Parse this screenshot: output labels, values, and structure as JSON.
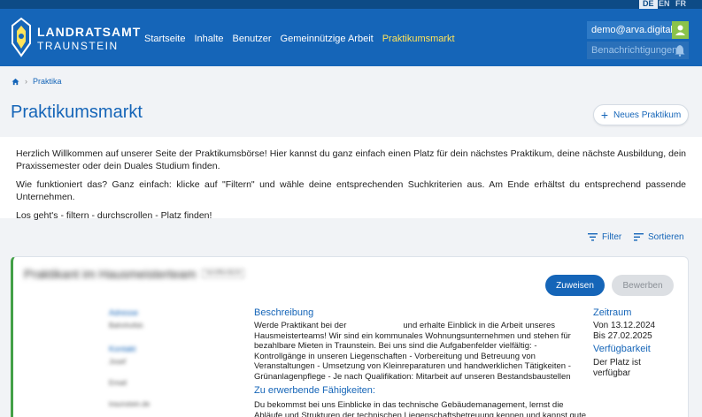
{
  "languages": [
    {
      "label": "DE",
      "active": true
    },
    {
      "label": "EN",
      "active": false
    },
    {
      "label": "FR",
      "active": false
    }
  ],
  "brand": {
    "line1": "LANDRATSAMT",
    "line2": "TRAUNSTEIN"
  },
  "nav": [
    {
      "label": "Startseite"
    },
    {
      "label": "Inhalte"
    },
    {
      "label": "Benutzer"
    },
    {
      "label": "Gemeinnützige Arbeit"
    },
    {
      "label": "Praktikumsmarkt",
      "active": true
    }
  ],
  "user": {
    "email": "demo@arva.digital",
    "notifications": "Benachrichtigungen"
  },
  "breadcrumb": {
    "current": "Praktika"
  },
  "page": {
    "title": "Praktikumsmarkt",
    "new_button": "Neues Praktikum"
  },
  "intro": {
    "p1": "Herzlich Willkommen auf unserer Seite der Praktikumsbörse! Hier kannst du ganz einfach einen Platz für dein nächstes Praktikum, deine nächste Ausbildung, dein Praxissemester oder dein Duales Studium finden.",
    "p2": "Wie funktioniert das? Ganz einfach: klicke auf \"Filtern\" und wähle deine entsprechenden Suchkriterien aus. Am Ende erhältst du entsprechend passende Unternehmen.",
    "p3": "Los geht's - filtern - durchscrollen - Platz finden!"
  },
  "toolbar": {
    "filter": "Filter",
    "sort": "Sortieren"
  },
  "card": {
    "title": "Praktikant im Hausmeisterteam",
    "badge": "Veröffentlicht",
    "assign": "Zuweisen",
    "rate": "Bewerben",
    "address_label": "Adresse",
    "address_value": "Bahnhofstr.",
    "contact_label": "Kontakt",
    "contact_name": "Josef",
    "contact_email": "Email",
    "contact_web": "traunstein.de",
    "desc_heading": "Beschreibung",
    "desc_part1": "Werde Praktikant bei der",
    "desc_part2": "und erhalte Einblick in die Arbeit unseres Hausmeisterteams! Wir sind ein kommunales Wohnungsunternehmen und stehen für bezahlbare Mieten in Traunstein. Bei uns sind die Aufgabenfelder vielfältig: - Kontrollgänge in unseren Liegenschaften - Vorbereitung und Betreuung von Veranstaltungen - Umsetzung von Kleinreparaturen und handwerklichen Tätigkeiten - Grünanlagenpflege - Je nach Qualifikation: Mitarbeit auf unseren Bestandsbaustellen",
    "skills_heading": "Zu erwerbende Fähigkeiten:",
    "skills_text": "Du bekommst bei uns Einblicke in das technische Gebäudemanagement, lernst die Abläufe und Strukturen der technischen Liegenschaftsbetreuung kennen und kannst gute Kontakte",
    "period_heading": "Zeitraum",
    "period_from": "Von 13.12.2024",
    "period_to": "Bis 27.02.2025",
    "avail_heading": "Verfügbarkeit",
    "avail_text": "Der Platz ist verfügbar"
  }
}
